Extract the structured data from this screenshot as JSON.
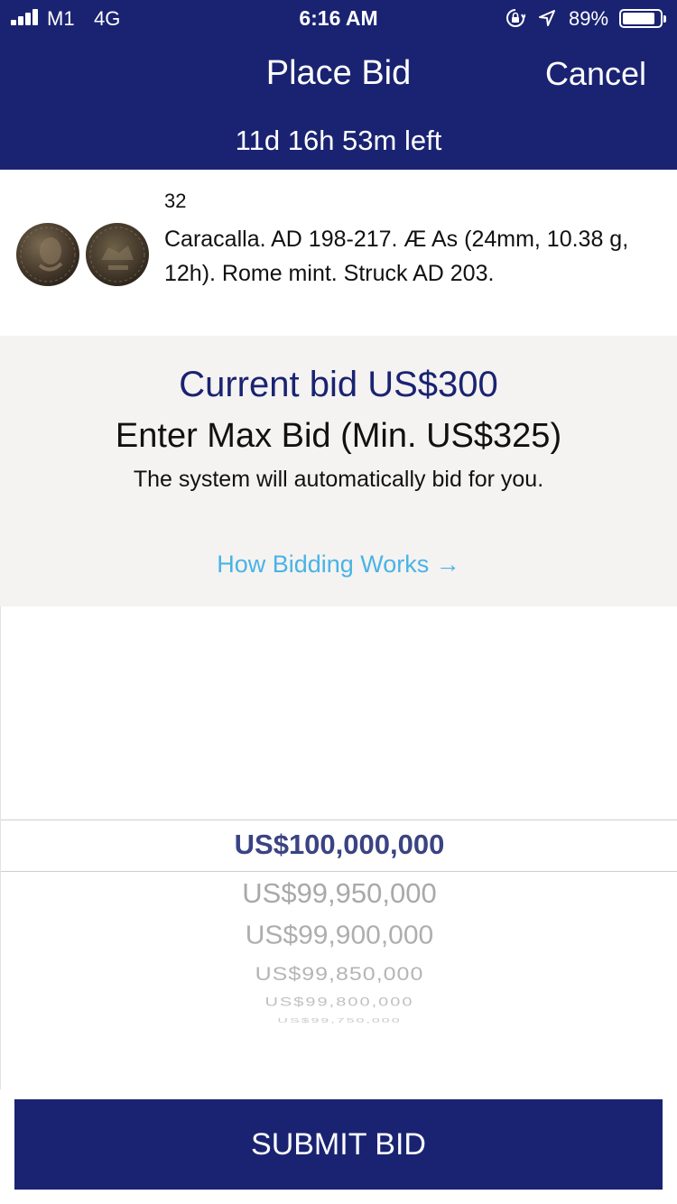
{
  "status_bar": {
    "carrier": "M1",
    "network": "4G",
    "time": "6:16 AM",
    "battery_percent": "89%",
    "battery_level": 0.89,
    "icons": [
      "signal-icon",
      "orientation-lock-icon",
      "location-icon",
      "battery-icon"
    ]
  },
  "nav": {
    "title": "Place Bid",
    "cancel_label": "Cancel",
    "time_left": "11d 16h 53m left"
  },
  "lot": {
    "number": "32",
    "title": "Caracalla. AD 198-217. Æ As (24mm, 10.38 g, 12h). Rome mint. Struck AD 203."
  },
  "bid_info": {
    "current_bid": "Current bid US$300",
    "enter_max": "Enter Max Bid (Min. US$325)",
    "auto_note": "The system will automatically bid for you.",
    "how_link": "How Bidding Works →"
  },
  "picker": {
    "selected": "US$100,000,000",
    "options": [
      "US$99,950,000",
      "US$99,900,000",
      "US$99,850,000",
      "US$99,800,000",
      "US$99,750,000"
    ]
  },
  "submit_label": "SUBMIT BID",
  "colors": {
    "header_bg": "#1a2372",
    "panel_bg": "#f4f3f1",
    "link": "#4ab3e6",
    "picker_selected": "#3a4383"
  }
}
